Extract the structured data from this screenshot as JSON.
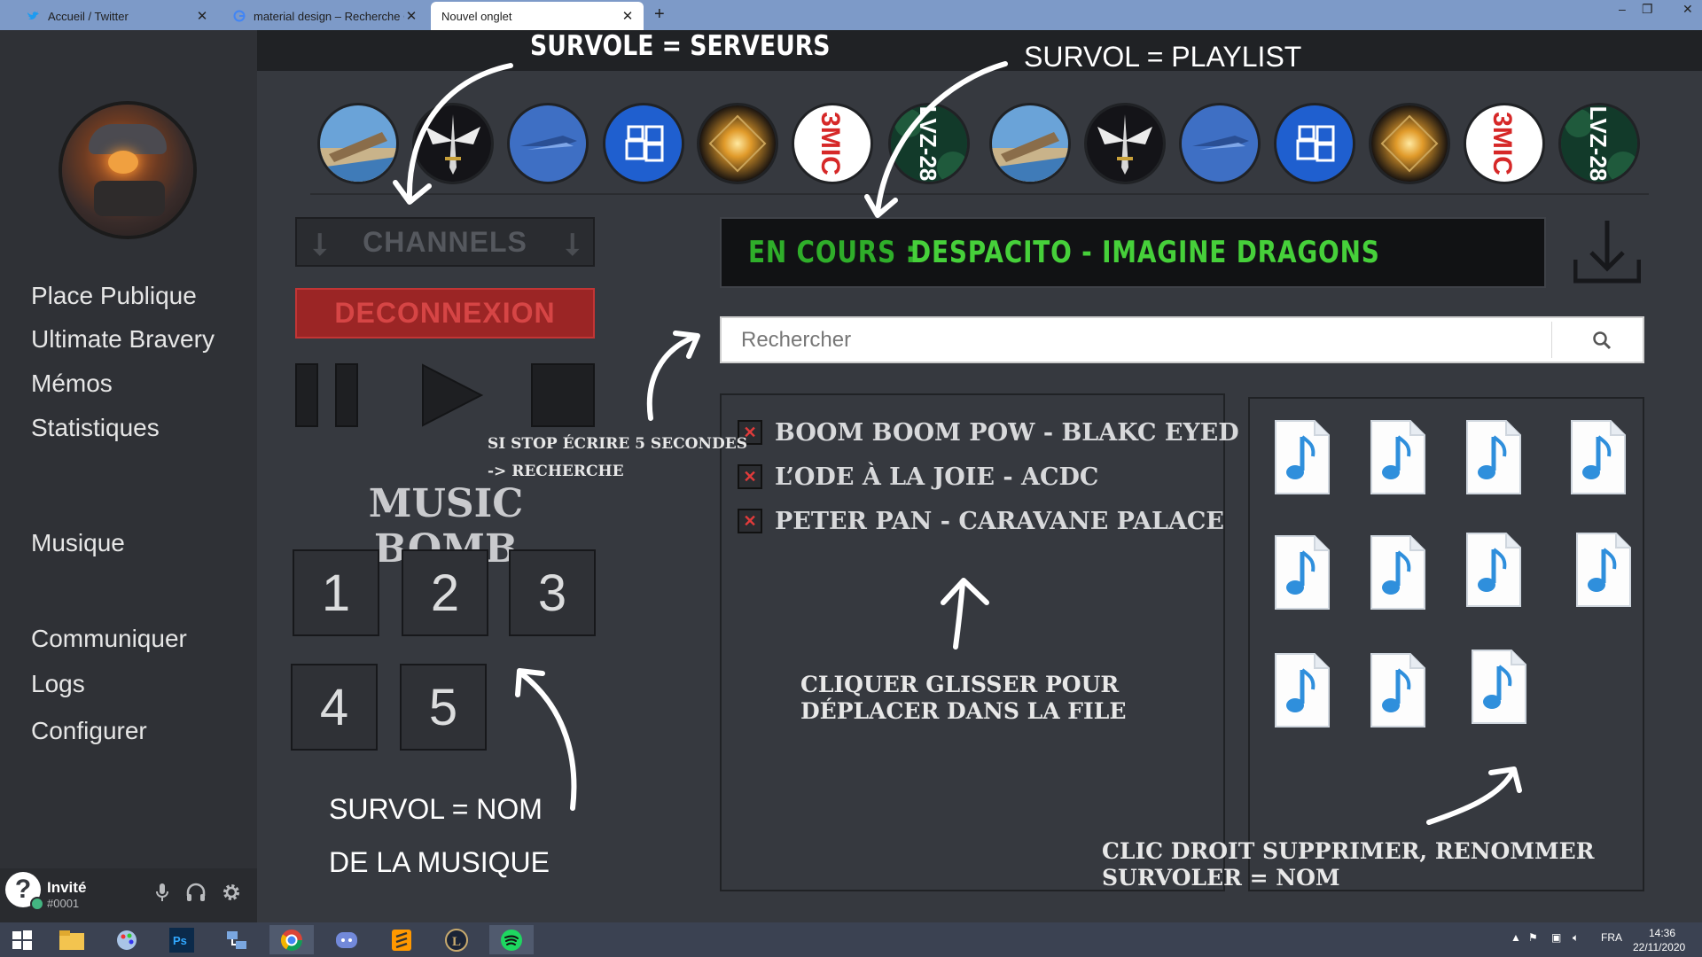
{
  "browser": {
    "tabs": [
      {
        "title": "Accueil / Twitter",
        "icon": "twitter-icon"
      },
      {
        "title": "material design – Recherche Goo",
        "icon": "google-icon"
      },
      {
        "title": "Nouvel onglet",
        "icon": "none"
      }
    ],
    "new_tab": "+",
    "close": "✕"
  },
  "sidebar": {
    "nav": [
      "Place Publique",
      "Ultimate Bravery",
      "Mémos",
      "Statistiques",
      "Musique",
      "Communiquer",
      "Logs",
      "Configurer"
    ]
  },
  "user": {
    "name": "Invité",
    "tag": "#0001",
    "avatar_glyph": "?"
  },
  "servers": [
    {
      "icon": "landscape-icon"
    },
    {
      "icon": "winged-sword-icon"
    },
    {
      "icon": "blade-icon"
    },
    {
      "icon": "windows-logo-icon"
    },
    {
      "icon": "glowing-emblem-icon"
    },
    {
      "icon": "3mic-logo-icon",
      "label": "3MIC"
    },
    {
      "icon": "lvz-logo-icon",
      "label": "LVZ-28"
    },
    {
      "icon": "landscape-icon"
    },
    {
      "icon": "winged-sword-icon"
    },
    {
      "icon": "blade-icon"
    },
    {
      "icon": "windows-logo-icon"
    },
    {
      "icon": "glowing-emblem-icon"
    },
    {
      "icon": "3mic-logo-icon",
      "label": "3MIC"
    },
    {
      "icon": "lvz-logo-icon",
      "label": "LVZ-28"
    }
  ],
  "controls": {
    "channels": "CHANNELS",
    "disconnect": "DECONNEXION",
    "music_bomb_title": "MUSIC BOMB",
    "bomb_buttons": [
      "1",
      "2",
      "3",
      "4",
      "5"
    ]
  },
  "now_playing": {
    "label": "EN COURS :",
    "song": "DESPACITO - IMAGINE DRAGONS"
  },
  "search": {
    "placeholder": "Rechercher"
  },
  "queue": [
    "BOOM BOOM POW - BLAKC EYED",
    "L’ODE À LA JOIE - ACDC",
    "PETER PAN - CARAVANE PALACE"
  ],
  "queue_remove_glyph": "✕",
  "files": {
    "count": 11
  },
  "annotations": {
    "survole_serveurs": "SURVOLE = SERVEURS",
    "survol_playlist": "SURVOL = PLAYLIST",
    "stop_line1": "SI STOP ÉCRIRE 5 SECONDES",
    "stop_line2": "-> RECHERCHE",
    "survol_nom_line1": "SURVOL = NOM",
    "survol_nom_line2": "DE LA MUSIQUE",
    "cliquer_line1": "CLIQUER GLISSER POUR",
    "cliquer_line2": "DÉPLACER DANS LA FILE",
    "clic_droit_line1": "CLIC DROIT SUPPRIMER, RENOMMER",
    "clic_droit_line2": "SURVOLER = NOM"
  },
  "taskbar": {
    "lang": "FRA",
    "time": "14:36",
    "date": "22/11/2020"
  },
  "colors": {
    "accent_green": "#46d03a",
    "disconnect_red": "#9b2525",
    "bg": "#36393f"
  }
}
